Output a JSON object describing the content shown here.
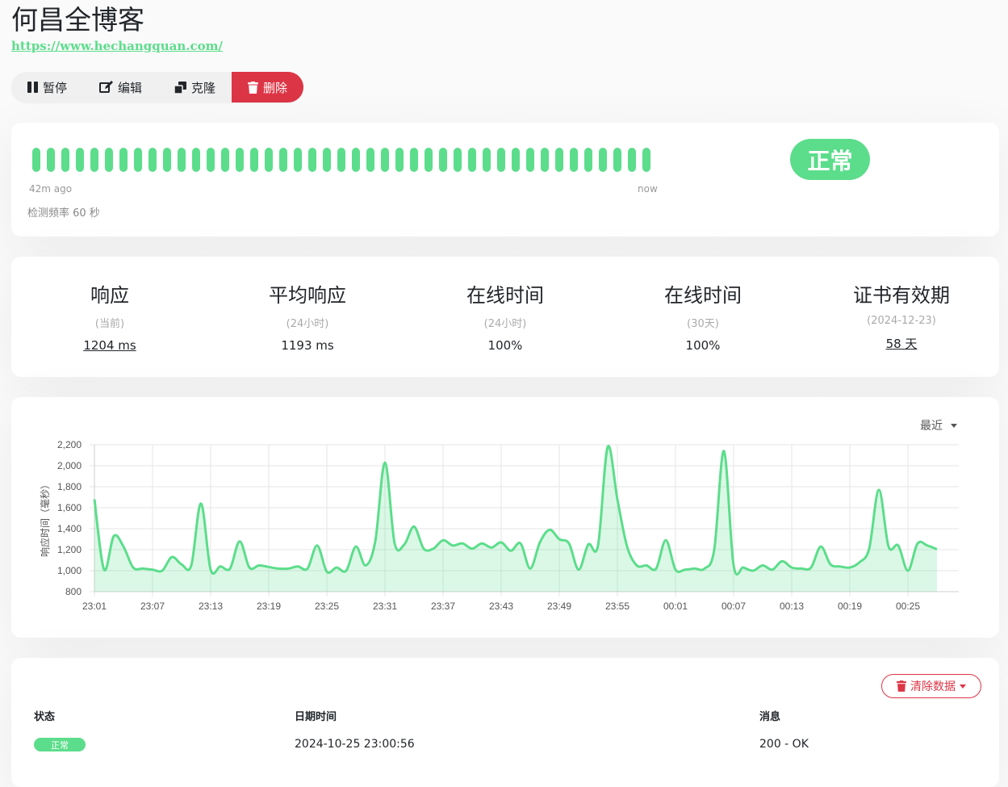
{
  "monitor": {
    "name": "何昌全博客",
    "url": "https://www.hechangquan.com/"
  },
  "actions": {
    "pause": "暂停",
    "edit": "编辑",
    "clone": "克隆",
    "delete": "删除"
  },
  "heartbeat": {
    "count": 43,
    "start_label": "42m ago",
    "end_label": "now",
    "interval_text": "检测频率 60 秒",
    "status": "正常",
    "color": "#5cdd8b"
  },
  "stats": [
    {
      "title": "响应",
      "sub": "(当前)",
      "value": "1204 ms"
    },
    {
      "title": "平均响应",
      "sub": "(24小时)",
      "value": "1193 ms"
    },
    {
      "title": "在线时间",
      "sub": "(24小时)",
      "value": "100%"
    },
    {
      "title": "在线时间",
      "sub": "(30天)",
      "value": "100%"
    },
    {
      "title": "证书有效期",
      "sub": "(2024-12-23)",
      "value": "58 天"
    }
  ],
  "chart_data": {
    "type": "area",
    "range_selector": "最近",
    "ylabel": "响应时间（毫秒）",
    "xlabel": "",
    "ylim": [
      800,
      2200
    ],
    "yticks": [
      800,
      1000,
      1200,
      1400,
      1600,
      1800,
      2000,
      2200
    ],
    "yticklabels": [
      "800",
      "1,000",
      "1,200",
      "1,400",
      "1,600",
      "1,800",
      "2,000",
      "2,200"
    ],
    "xticklabels": [
      "23:01",
      "23:07",
      "23:13",
      "23:19",
      "23:25",
      "23:31",
      "23:37",
      "23:43",
      "23:49",
      "23:55",
      "00:01",
      "00:07",
      "00:13",
      "00:19",
      "00:25"
    ],
    "grid": true,
    "color": "#5cdd8b",
    "series": [
      {
        "values": [
          1680,
          1010,
          1330,
          1230,
          1030,
          1020,
          1010,
          1000,
          1130,
          1060,
          1050,
          1640,
          1010,
          1040,
          1020,
          1280,
          1030,
          1050,
          1035,
          1020,
          1020,
          1040,
          1020,
          1240,
          990,
          1030,
          1000,
          1230,
          1050,
          1280,
          2030,
          1260,
          1250,
          1420,
          1210,
          1210,
          1290,
          1240,
          1260,
          1210,
          1260,
          1220,
          1270,
          1190,
          1260,
          1020,
          1270,
          1390,
          1300,
          1260,
          1010,
          1250,
          1240,
          2180,
          1680,
          1230,
          1050,
          1050,
          1020,
          1290,
          1010,
          1010,
          1020,
          1020,
          1200,
          2140,
          1050,
          1030,
          1000,
          1050,
          1010,
          1090,
          1030,
          1020,
          1030,
          1230,
          1060,
          1040,
          1030,
          1080,
          1210,
          1770,
          1230,
          1240,
          1000,
          1260,
          1240,
          1204
        ]
      }
    ]
  },
  "events": {
    "clear_label": "清除数据",
    "headers": {
      "status": "状态",
      "datetime": "日期时间",
      "message": "消息"
    },
    "rows": [
      {
        "status": "正常",
        "datetime": "2024-10-25 23:00:56",
        "message": "200 - OK"
      }
    ]
  }
}
